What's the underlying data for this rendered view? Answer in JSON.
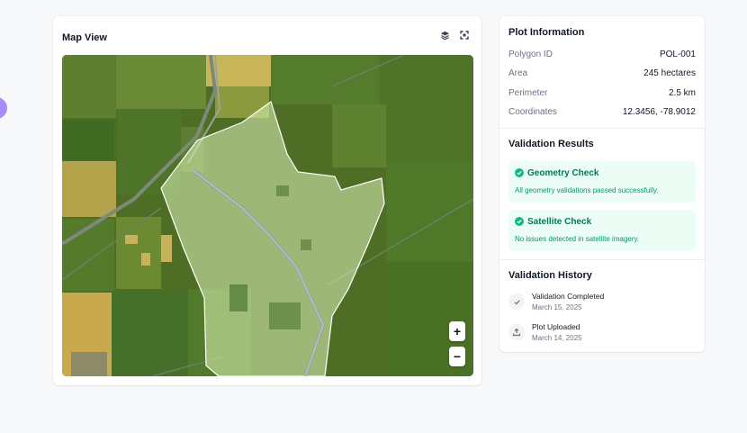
{
  "map": {
    "title": "Map View",
    "zoom_in": "+",
    "zoom_out": "−"
  },
  "plot_info": {
    "title": "Plot Information",
    "rows": [
      {
        "label": "Polygon ID",
        "value": "POL-001"
      },
      {
        "label": "Area",
        "value": "245 hectares"
      },
      {
        "label": "Perimeter",
        "value": "2.5 km"
      },
      {
        "label": "Coordinates",
        "value": "12.3456, -78.9012"
      }
    ]
  },
  "validation": {
    "title": "Validation Results",
    "checks": [
      {
        "title": "Geometry Check",
        "description": "All geometry validations passed successfully."
      },
      {
        "title": "Satellite Check",
        "description": "No issues detected in satellite imagery."
      }
    ]
  },
  "history": {
    "title": "Validation History",
    "items": [
      {
        "title": "Validation Completed",
        "date": "March 15, 2025",
        "icon": "check-icon"
      },
      {
        "title": "Plot Uploaded",
        "date": "March 14, 2025",
        "icon": "upload-icon"
      }
    ]
  },
  "colors": {
    "accent_green": "#047857",
    "success_bg": "#ecfdf5",
    "polygon_fill": "#dff5b8"
  }
}
